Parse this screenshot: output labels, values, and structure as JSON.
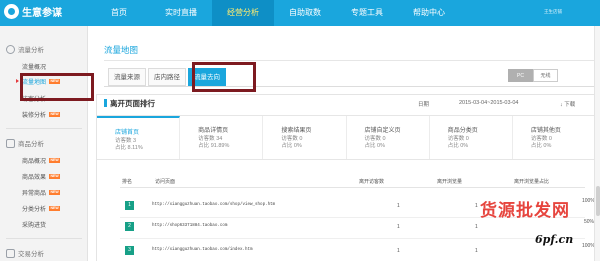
{
  "app": {
    "name": "生意参谋",
    "user": "王生店铺"
  },
  "nav": [
    "首页",
    "实时直播",
    "经营分析",
    "自助取数",
    "专题工具",
    "帮助中心"
  ],
  "sidebar": {
    "sections": [
      {
        "title": "流量分析",
        "items": [
          "流量概况",
          "流量地图",
          "访客分析",
          "装修分析"
        ]
      },
      {
        "title": "商品分析",
        "items": [
          "商品概况",
          "商品效果",
          "异常商品",
          "分类分析",
          "采购进货"
        ]
      },
      {
        "title": "交易分析"
      }
    ],
    "new_tag": "NEW"
  },
  "page": {
    "title": "流量地图"
  },
  "tabs": [
    "流量来源",
    "店内路径",
    "流量去向"
  ],
  "device_toggle": [
    "PC",
    "无线"
  ],
  "panel": {
    "title": "离开页面排行",
    "date_label": "日期",
    "date_range": "2015-03-04~2015-03-04",
    "download": "下载"
  },
  "metrics": [
    {
      "name": "店铺首页",
      "visitors": "访客数 3",
      "share": "占比 8.11%"
    },
    {
      "name": "商品详情页",
      "visitors": "访客数 34",
      "share": "占比 91.89%"
    },
    {
      "name": "搜索结果页",
      "visitors": "访客数 0",
      "share": "占比 0%"
    },
    {
      "name": "店铺自定义页",
      "visitors": "访客数 0",
      "share": "占比 0%"
    },
    {
      "name": "商品分类页",
      "visitors": "访客数 0",
      "share": "占比 0%"
    },
    {
      "name": "店铺其他页",
      "visitors": "访客数 0",
      "share": "占比 0%"
    }
  ],
  "table": {
    "headers": [
      "排名",
      "访问页面",
      "离开访客数",
      "离开浏览量",
      "离开浏览量占比"
    ],
    "rows": [
      {
        "rank": "1",
        "url": "http://xiangguzhuan.taobao.com/shop/view_shop.htm",
        "visitors": "1",
        "views": "1",
        "pct": "100%",
        "pct_value": 100
      },
      {
        "rank": "2",
        "url": "http://shop63371884.taobao.com",
        "visitors": "1",
        "views": "1",
        "pct": "50%",
        "pct_value": 50
      },
      {
        "rank": "3",
        "url": "http://xiangguzhuan.taobao.com/index.htm",
        "visitors": "1",
        "views": "1",
        "pct": "100%",
        "pct_value": 100
      }
    ]
  },
  "watermark": {
    "text": "货源批发网",
    "site": "6pf.cn"
  },
  "colors": {
    "primary": "#1aa6dd",
    "new_tag": "#ff7d2e",
    "rank_badge": "#17a087",
    "highlight_box": "#7d1a20",
    "watermark": "#e2251d"
  }
}
